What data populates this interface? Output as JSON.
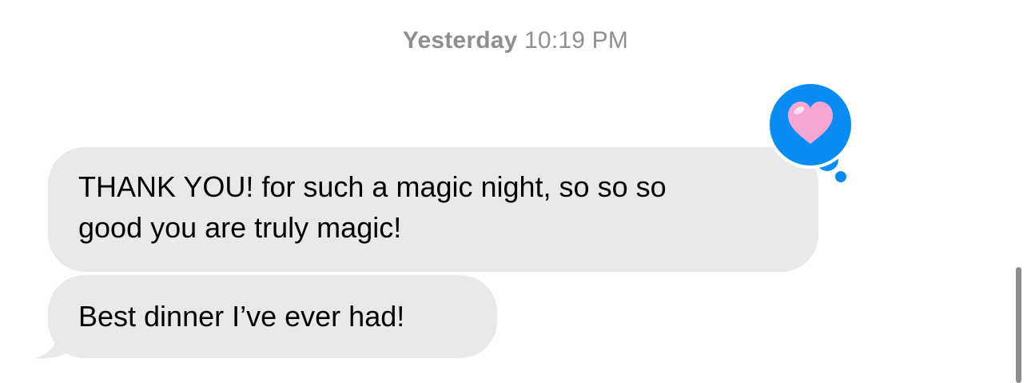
{
  "timestamp": {
    "day": "Yesterday",
    "time": "10:19 PM"
  },
  "messages": [
    {
      "lines": [
        "THANK YOU! for such a magic night, so so so",
        "good you are truly magic!"
      ],
      "direction": "incoming",
      "reaction": "heart"
    },
    {
      "lines": [
        "Best dinner I’ve ever had!"
      ],
      "direction": "incoming"
    }
  ],
  "colors": {
    "incoming_bubble": "#e9e9eb",
    "tapback_blue": "#0a8cf5",
    "heart_pink": "#f7a6d4",
    "timestamp_gray": "#8e8e93"
  },
  "icons": {
    "tapback": "heart-icon"
  }
}
